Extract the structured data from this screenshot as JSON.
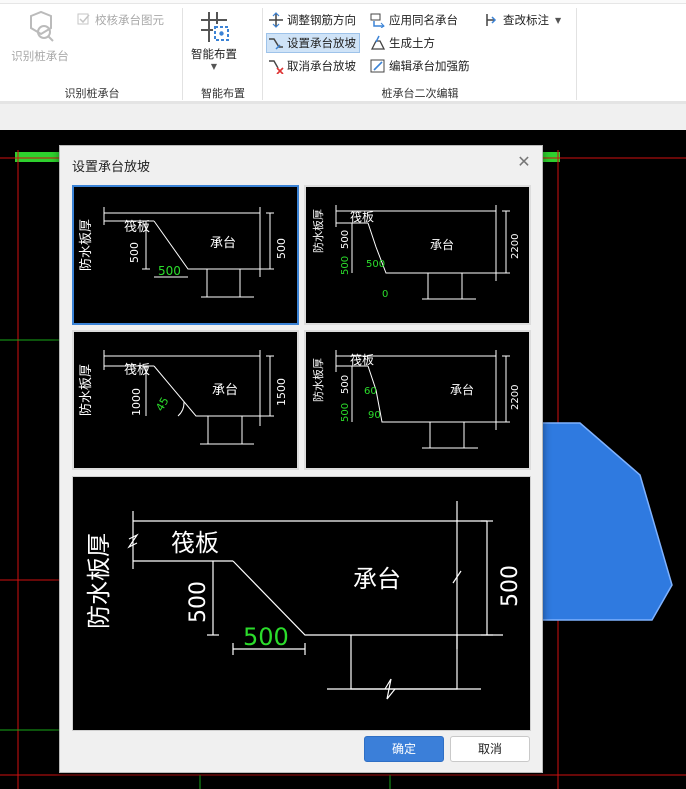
{
  "ribbon": {
    "groups": [
      {
        "label": "识别桩承台"
      },
      {
        "label": "智能布置"
      },
      {
        "label": "桩承台二次编辑"
      }
    ],
    "identify_button": "识别桩承台",
    "check_button": "校核承台图元",
    "smart_layout_button": "智能布置",
    "edit_buttons": {
      "adjust_rebar": "调整钢筋方向",
      "apply_same_name": "应用同名承台",
      "modify_annotation": "查改标注",
      "set_slope": "设置承台放坡",
      "generate_earthwork": "生成土方",
      "cancel_slope": "取消承台放坡",
      "edit_reinforce": "编辑承台加强筋"
    }
  },
  "dialog": {
    "title": "设置承台放坡",
    "ok_label": "确定",
    "cancel_label": "取消"
  },
  "options": [
    {
      "waterproof": "防水板厚",
      "raft": "筏板",
      "cap": "承台",
      "depth": "500",
      "height": "500",
      "width": "500"
    },
    {
      "waterproof": "防水板厚",
      "raft": "筏板",
      "cap": "承台",
      "depth": "500",
      "height": "2200",
      "step1": "500",
      "step_w": "500",
      "zero": "0"
    },
    {
      "waterproof": "防水板厚",
      "raft": "筏板",
      "cap": "承台",
      "depth": "1000",
      "height": "1500",
      "angle": "45"
    },
    {
      "waterproof": "防水板厚",
      "raft": "筏板",
      "cap": "承台",
      "depth": "500",
      "height": "2200",
      "step1": "500",
      "angle1": "60",
      "angle2": "90"
    }
  ],
  "preview": {
    "waterproof": "防水板厚",
    "raft": "筏板",
    "cap": "承台",
    "depth": "500",
    "height": "500",
    "width": "500"
  },
  "selected_option": 1,
  "colors": {
    "dim_green": "#2bdc2b",
    "accent": "#3b7fd9",
    "slope_fill": "#2f7ae0",
    "grid_red": "#d01010",
    "grid_green": "#19a819"
  }
}
